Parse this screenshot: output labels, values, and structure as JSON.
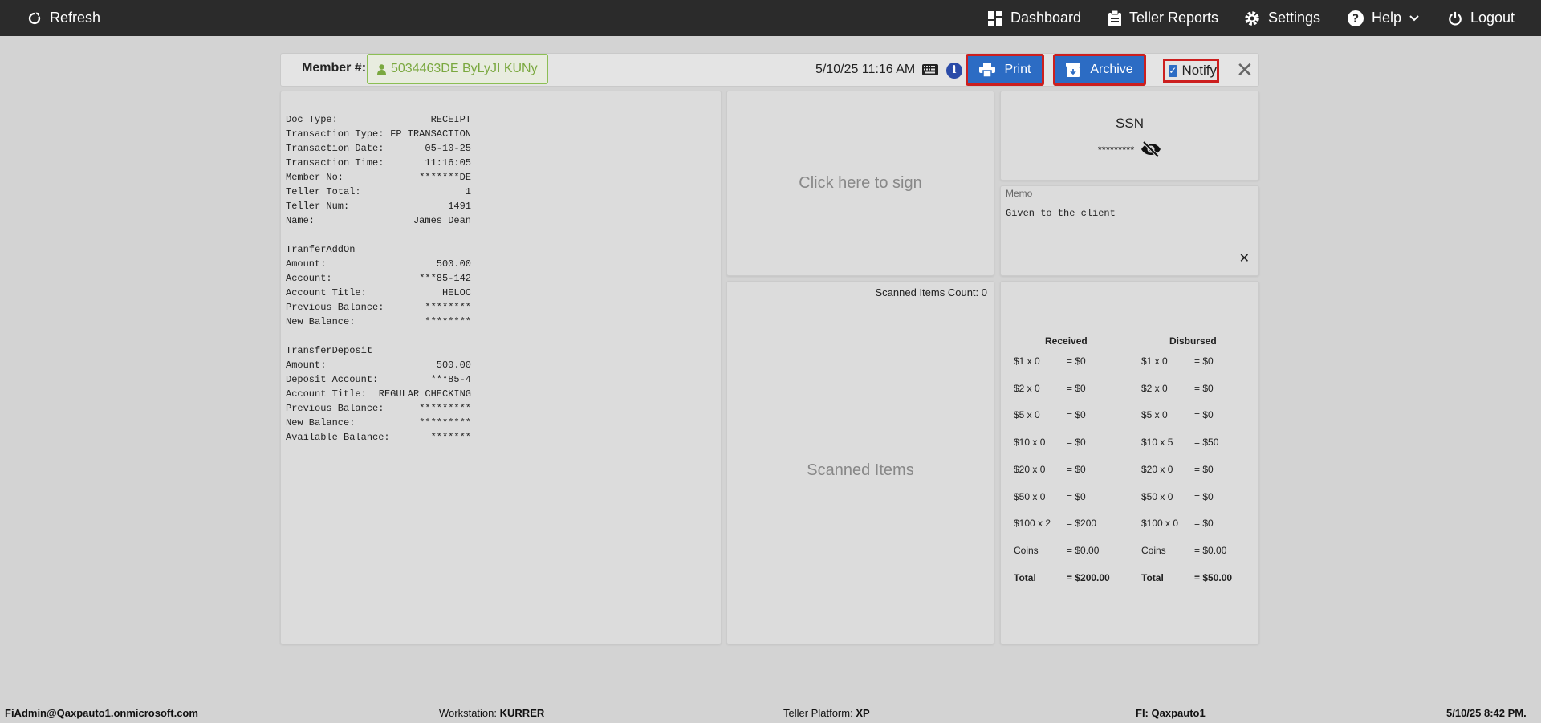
{
  "nav": {
    "refresh": "Refresh",
    "dashboard": "Dashboard",
    "teller_reports": "Teller Reports",
    "settings": "Settings",
    "help": "Help",
    "logout": "Logout"
  },
  "header": {
    "member_label": "Member #:",
    "member_value": "5034463DE ByLyJI KUNy",
    "datetime": "5/10/25 11:16 AM",
    "info_symbol": "i",
    "print_label": "Print",
    "archive_label": "Archive",
    "notify_label": "Notify",
    "notify_checked": true,
    "close_symbol": "✕"
  },
  "receipt": {
    "lines": [
      [
        "Doc Type:",
        "RECEIPT"
      ],
      [
        "Transaction Type:",
        "FP TRANSACTION"
      ],
      [
        "Transaction Date:",
        "05-10-25"
      ],
      [
        "Transaction Time:",
        "11:16:05"
      ],
      [
        "Member No:",
        "*******DE"
      ],
      [
        "Teller Total:",
        "1"
      ],
      [
        "Teller Num:",
        "1491"
      ],
      [
        "Name:",
        "James Dean"
      ],
      [
        "",
        ""
      ],
      [
        "TranferAddOn",
        ""
      ],
      [
        "Amount:",
        "500.00"
      ],
      [
        "Account:",
        "***85-142"
      ],
      [
        "Account Title:",
        "HELOC"
      ],
      [
        "Previous Balance:",
        "********"
      ],
      [
        "New Balance:",
        "********"
      ],
      [
        "",
        ""
      ],
      [
        "TransferDeposit",
        ""
      ],
      [
        "Amount:",
        "500.00"
      ],
      [
        "Deposit Account:",
        "***85-4"
      ],
      [
        "Account Title:",
        "REGULAR CHECKING"
      ],
      [
        "Previous Balance:",
        "*********"
      ],
      [
        "New Balance:",
        "*********"
      ],
      [
        "Available Balance:",
        "*******"
      ]
    ]
  },
  "signature": {
    "prompt": "Click here to sign"
  },
  "scanned": {
    "count_label": "Scanned Items Count: 0",
    "label": "Scanned Items"
  },
  "ssn": {
    "title": "SSN",
    "masked": "*********"
  },
  "memo": {
    "label": "Memo",
    "value": "Given to the client",
    "clear_symbol": "✕"
  },
  "cash": {
    "received_title": "Received",
    "disbursed_title": "Disbursed",
    "received": [
      [
        "$1 x 0",
        "= $0"
      ],
      [
        "$2 x 0",
        "= $0"
      ],
      [
        "$5 x 0",
        "= $0"
      ],
      [
        "$10 x 0",
        "= $0"
      ],
      [
        "$20 x 0",
        "= $0"
      ],
      [
        "$50 x 0",
        "= $0"
      ],
      [
        "$100 x 2",
        "= $200"
      ],
      [
        "Coins",
        "= $0.00"
      ],
      [
        "Total",
        "= $200.00"
      ]
    ],
    "disbursed": [
      [
        "$1 x 0",
        "= $0"
      ],
      [
        "$2 x 0",
        "= $0"
      ],
      [
        "$5 x 0",
        "= $0"
      ],
      [
        "$10 x 5",
        "= $50"
      ],
      [
        "$20 x 0",
        "= $0"
      ],
      [
        "$50 x 0",
        "= $0"
      ],
      [
        "$100 x 0",
        "= $0"
      ],
      [
        "Coins",
        "= $0.00"
      ],
      [
        "Total",
        "= $50.00"
      ]
    ]
  },
  "footer": {
    "user": "FiAdmin@Qaxpauto1.onmicrosoft.com",
    "workstation_label": "Workstation:",
    "workstation_value": "KURRER",
    "platform_label": "Teller Platform:",
    "platform_value": "XP",
    "fi_label": "FI:",
    "fi_value": "Qaxpauto1",
    "datetime": "5/10/25 8:42 PM."
  },
  "colors": {
    "topbar": "#2b2b2b",
    "button": "#2c6cc4",
    "highlight_border": "#cc1f1f",
    "member_green": "#7aa83f"
  }
}
